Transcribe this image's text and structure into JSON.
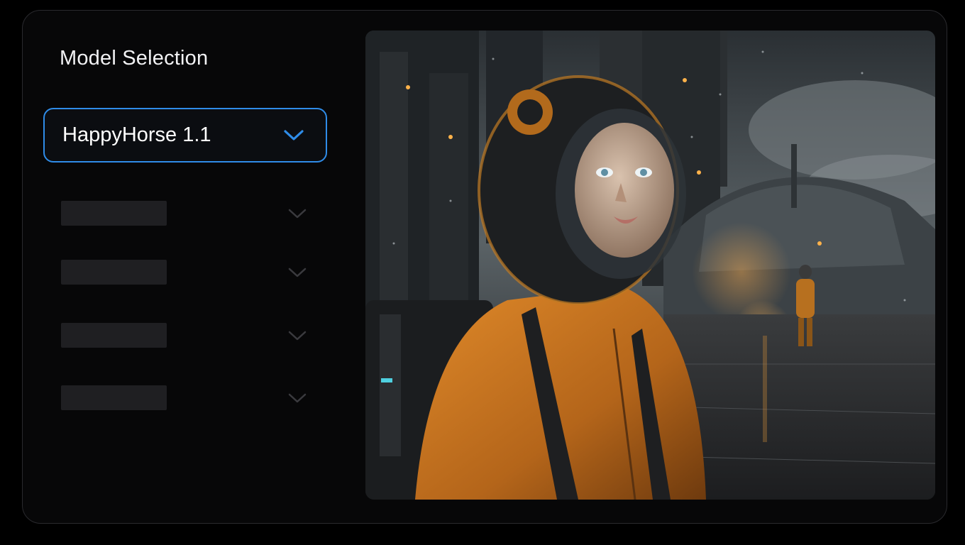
{
  "panel": {
    "title": "Model Selection"
  },
  "model_select": {
    "selected": "HappyHorse 1.1",
    "icon": "chevron-down-icon",
    "accent": "#2f8ce8"
  },
  "placeholder_rows": [
    {
      "icon": "chevron-down-icon"
    },
    {
      "icon": "chevron-down-icon"
    },
    {
      "icon": "chevron-down-icon"
    },
    {
      "icon": "chevron-down-icon"
    }
  ],
  "preview": {
    "subject": "astronaut-in-orange-suit-rainy-futuristic-city",
    "colors": {
      "suit": "#c9731c",
      "sky": "#4a5256",
      "glow": "#f0a040"
    }
  }
}
